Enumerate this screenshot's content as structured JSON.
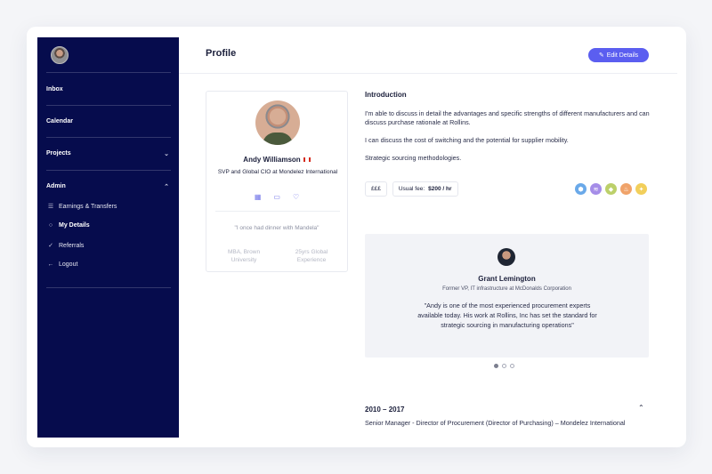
{
  "sidebar": {
    "items": [
      {
        "label": "Inbox"
      },
      {
        "label": "Calendar"
      },
      {
        "label": "Projects"
      },
      {
        "label": "Admin"
      }
    ],
    "admin_sub": [
      {
        "label": "Earnings & Transfers",
        "icon": "sliders-icon"
      },
      {
        "label": "My Details",
        "icon": "user-icon"
      },
      {
        "label": "Referrals",
        "icon": "check-icon"
      },
      {
        "label": "Logout",
        "icon": "logout-arrow-icon"
      }
    ]
  },
  "header": {
    "title": "Profile",
    "edit_label": "Edit Details"
  },
  "profile": {
    "name": "Andy Williamson",
    "role": "SVP and Global CIO at Mondelez International",
    "quote": "\"I once had dinner with Mandela\"",
    "stats": [
      "MBA, Brown University",
      "25yrs Global Experience"
    ]
  },
  "intro": {
    "heading": "Introduction",
    "paragraphs": [
      "I'm able to discuss in detail the advantages and specific strengths of different manufacturers and can discuss purchase rationale at Rollins.",
      "I can discuss the cost of switching and the potential for supplier mobility.",
      "Strategic sourcing methodologies."
    ],
    "price_tier": "£££",
    "fee_label": "Usual fee:",
    "fee_value": "$200 / hr"
  },
  "badges": [
    {
      "icon": "badge-blue-icon",
      "color": "#6aa9e9"
    },
    {
      "icon": "badge-purple-icon",
      "color": "#a58de8"
    },
    {
      "icon": "badge-lime-icon",
      "color": "#bcd06a"
    },
    {
      "icon": "badge-orange-icon",
      "color": "#f0a36a"
    },
    {
      "icon": "badge-yellow-icon",
      "color": "#f2cf5b"
    }
  ],
  "testimonial": {
    "name": "Grant Lemington",
    "role": "Former VP, IT infrastructure at McDonalds Corporation",
    "quote": "\"Andy is one of the most experienced procurement experts available today. His work at Rollins, Inc has set the standard for strategic sourcing in manufacturing operations\""
  },
  "experience": {
    "years": "2010 – 2017",
    "title": "Senior Manager - Director of Procurement (Director of Purchasing) – Mondelez International"
  },
  "colors": {
    "sidebar_bg": "#060c4d",
    "accent": "#5b5ef0"
  }
}
